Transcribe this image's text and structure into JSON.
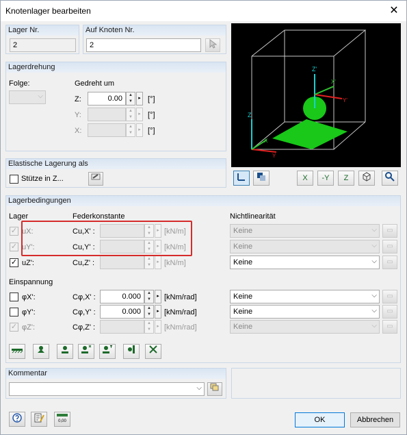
{
  "window": {
    "title": "Knotenlager bearbeiten",
    "close_glyph": "✕"
  },
  "lager_nr": {
    "label": "Lager Nr.",
    "value": "2"
  },
  "auf_knoten": {
    "label": "Auf Knoten Nr.",
    "value": "2"
  },
  "drehung": {
    "title": "Lagerdrehung",
    "folge_label": "Folge:",
    "gedreht_label": "Gedreht um",
    "z_label": "Z:",
    "z_value": "0.00",
    "y_label": "Y:",
    "y_value": "",
    "x_label": "X:",
    "x_value": "",
    "unit": "[°]"
  },
  "elastisch": {
    "title": "Elastische Lagerung als",
    "stuetze_label": "Stütze in Z..."
  },
  "bedingungen": {
    "title": "Lagerbedingungen",
    "col_lager": "Lager",
    "col_feder": "Federkonstante",
    "col_nl": "Nichtlinearität",
    "rows": [
      {
        "name": "ux",
        "label": "uX:",
        "spring": "Cu,X' :",
        "value": "",
        "unit": "[kN/m]",
        "nl": "Keine"
      },
      {
        "name": "uy",
        "label": "uY':",
        "spring": "Cu,Y' :",
        "value": "",
        "unit": "[kN/m]",
        "nl": "Keine"
      },
      {
        "name": "uz",
        "label": "uZ':",
        "spring": "Cu,Z' :",
        "value": "",
        "unit": "[kN/m]",
        "nl": "Keine"
      }
    ],
    "einspannung_label": "Einspannung",
    "rot_rows": [
      {
        "name": "phix",
        "label": "φX':",
        "spring": "Cφ,X' :",
        "value": "0.000",
        "unit": "[kNm/rad]",
        "nl": "Keine"
      },
      {
        "name": "phiy",
        "label": "φY':",
        "spring": "Cφ,Y' :",
        "value": "0.000",
        "unit": "[kNm/rad]",
        "nl": "Keine"
      },
      {
        "name": "phiz",
        "label": "φZ':",
        "spring": "Cφ,Z' :",
        "value": "",
        "unit": "[kNm/rad]",
        "nl": "Keine"
      }
    ]
  },
  "kommentar": {
    "title": "Kommentar",
    "value": ""
  },
  "footer": {
    "ok": "OK",
    "cancel": "Abbrechen",
    "zero_icon_label": "0,00"
  },
  "preview_axes": {
    "z": "Z",
    "x": "X",
    "y": "Y",
    "zp": "Z'",
    "xp": "X'",
    "yp": "Y'"
  },
  "view_buttons": {
    "x": "X",
    "y": "-Y",
    "z": "Z"
  },
  "colors": {
    "highlight": "#d62b2b",
    "support": "#19c819",
    "axis_z": "#19d0d0",
    "axis_x": "#e02020",
    "axis_y": "#30c030"
  }
}
